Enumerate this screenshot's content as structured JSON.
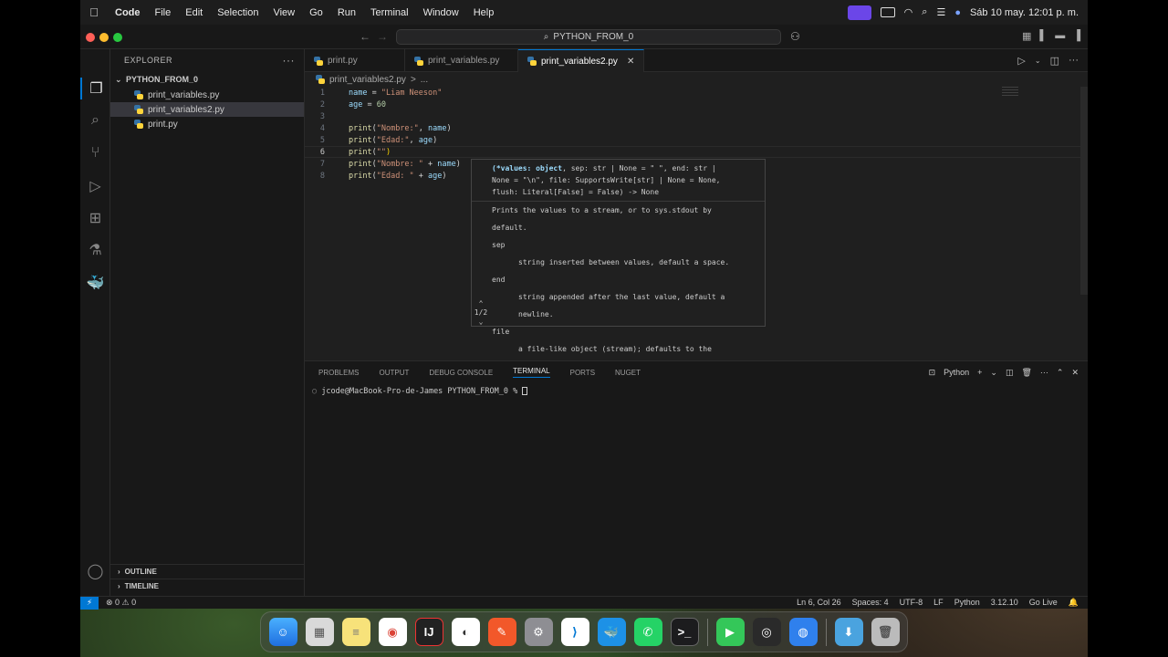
{
  "menubar": {
    "apple": "",
    "app": "Code",
    "menus": [
      "File",
      "Edit",
      "Selection",
      "View",
      "Go",
      "Run",
      "Terminal",
      "Window",
      "Help"
    ],
    "datetime": "Sáb 10 may.  12:01 p. m."
  },
  "titlebar": {
    "search": "PYTHON_FROM_0"
  },
  "explorer": {
    "title": "EXPLORER",
    "more": "···",
    "folder": "PYTHON_FROM_0",
    "files": [
      "print_variables.py",
      "print_variables2.py",
      "print.py"
    ],
    "selected_file": "print_variables2.py",
    "outline": "OUTLINE",
    "timeline": "TIMELINE"
  },
  "tabs": [
    "print.py",
    "print_variables.py",
    "print_variables2.py"
  ],
  "active_tab": "print_variables2.py",
  "breadcrumb": {
    "file": "print_variables2.py",
    "sep": ">",
    "more": "..."
  },
  "editor": {
    "lines": [
      {
        "n": "1"
      },
      {
        "n": "2"
      },
      {
        "n": "3"
      },
      {
        "n": "4"
      },
      {
        "n": "5"
      },
      {
        "n": "6"
      },
      {
        "n": "7"
      },
      {
        "n": "8"
      }
    ],
    "tokens": {
      "l1_var": "name",
      "l1_op": " = ",
      "l1_str": "\"Liam Neeson\"",
      "l2_var": "age",
      "l2_op": " = ",
      "l2_num": "60",
      "l4_fn": "print",
      "l4_a": "(",
      "l4_str": "\"Nombre:\"",
      "l4_b": ", ",
      "l4_var": "name",
      "l4_c": ")",
      "l5_fn": "print",
      "l5_a": "(",
      "l5_str": "\"Edad:\"",
      "l5_b": ", ",
      "l5_var": "age",
      "l5_c": ")",
      "l6_fn": "print",
      "l6_a": "(",
      "l6_str": "\"\"",
      "l6_c": ")",
      "l7_fn": "print",
      "l7_a": "(",
      "l7_str": "\"Nombre: \"",
      "l7_b": " + ",
      "l7_var": "name",
      "l7_c": ")",
      "l8_fn": "print",
      "l8_a": "(",
      "l8_str": "\"Edad: \"",
      "l8_b": " + ",
      "l8_var": "age",
      "l8_c": ")"
    }
  },
  "hover": {
    "sig_param": "(*values: object",
    "sig_rest1": ", sep: str | None = \" \", end: str |",
    "sig_rest2": "None = \"\\n\", file: SupportsWrite[str] | None = None,",
    "sig_rest3": "flush: Literal[False] = False) -> None",
    "desc": "Prints the values to a stream, or to sys.stdout by default.",
    "sep_name": "sep",
    "sep_desc": "string inserted between values, default a space.",
    "end_name": "end",
    "end_desc": "string appended after the last value, default a newline.",
    "file_name": "file",
    "file_desc": "a file-like object (stream); defaults to the current sys.stdout.",
    "pager": "1/2"
  },
  "panel": {
    "tabs": [
      "PROBLEMS",
      "OUTPUT",
      "DEBUG CONSOLE",
      "TERMINAL",
      "PORTS",
      "NUGET"
    ],
    "active": "TERMINAL",
    "shell": "Python",
    "prompt": "jcode@MacBook-Pro-de-James PYTHON_FROM_0 % "
  },
  "status": {
    "problems": "⊗ 0 ⚠ 0",
    "position": "Ln 6, Col 26",
    "spaces": "Spaces: 4",
    "encoding": "UTF-8",
    "eol": "LF",
    "language": "Python",
    "version": "3.12.10",
    "golive": "Go Live"
  },
  "colors": {
    "accent": "#0078d4",
    "background": "#1f1f1f",
    "sidebar": "#181818"
  }
}
